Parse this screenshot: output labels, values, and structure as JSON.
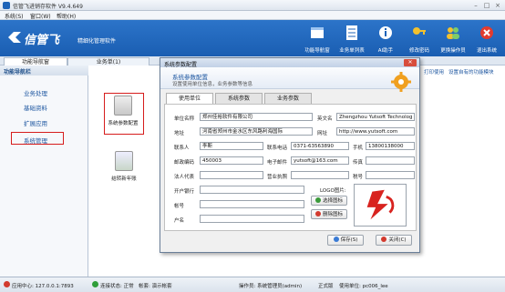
{
  "window": {
    "title": "信管飞进销存软件 V9.4.649"
  },
  "menu": [
    "系统(S)",
    "窗口(W)",
    "帮助(H)"
  ],
  "header": {
    "brand": "信管飞",
    "slogan": "精细化管理软件",
    "tools": [
      {
        "label": "功能导航窗",
        "icon": "nav-window-icon"
      },
      {
        "label": "业务单列表",
        "icon": "document-list-icon"
      },
      {
        "label": "AI助手",
        "icon": "info-icon"
      },
      {
        "label": "修改密码",
        "icon": "key-icon"
      },
      {
        "label": "更换操作员",
        "icon": "users-icon"
      },
      {
        "label": "退出系统",
        "icon": "exit-icon"
      }
    ]
  },
  "tabs": [
    "功能导航窗",
    "业务单(1)"
  ],
  "nav": {
    "header": "功能导航栏",
    "items": [
      "业务处理",
      "基础资料",
      "扩展应用",
      "系统管理"
    ]
  },
  "features": [
    {
      "label": "系统参数配置"
    },
    {
      "label": "结转新年账"
    }
  ],
  "right_links": [
    "打印使用",
    "设置自有的功能模块"
  ],
  "dialog": {
    "title": "系统参数配置",
    "banner_title": "系统参数配置",
    "banner_sub": "设置使用单位信息，业务参数等信息",
    "tabs": [
      "使用单位",
      "系统参数",
      "业务参数"
    ],
    "fields": {
      "unit_name_label": "单位名称",
      "unit_name": "郑州佳裕软件有限公司",
      "en_name_label": "英文名",
      "en_name": "Zhengzhou Yutsoft Technolog",
      "address_label": "地址",
      "address": "河南省郑州市金水区东风路利海国际",
      "website_label": "网址",
      "website": "http://www.yutsoft.com",
      "contact_label": "联系人",
      "contact": "李斯",
      "phone_label": "联系电话",
      "phone": "0371-63563890",
      "mobile_label": "手机",
      "mobile": "13800138000",
      "zip_label": "邮政编码",
      "zip": "450003",
      "email_label": "电子邮件",
      "email": "yutsoft@163.com",
      "fax_label": "传真",
      "fax": "",
      "legal_label": "法人代表",
      "legal": "",
      "license_label": "营业执照",
      "license": "",
      "tax_label": "税号",
      "tax": "",
      "bank_label": "开户银行",
      "bank": "",
      "account_label": "帐号",
      "account": "",
      "holder_label": "户名",
      "holder": "",
      "logo_label": "LOGO图片:"
    },
    "buttons": {
      "choose_logo": "选择图标",
      "delete_logo": "删除图标",
      "save": "保存(S)",
      "close": "关闭(C)"
    }
  },
  "status": {
    "app_center": "应用中心: 127.0.0.1:7893",
    "connection": "连接状态: 正常",
    "account_set": "帐套: 演示帐套",
    "operator": "操作员: 系统管理员(admin)",
    "edition": "正式版",
    "user": "使用单位: pc006_lee"
  },
  "colors": {
    "header_blue": "#1d63b8",
    "highlight_red": "#d61c1c",
    "link_blue": "#1d56a0"
  }
}
